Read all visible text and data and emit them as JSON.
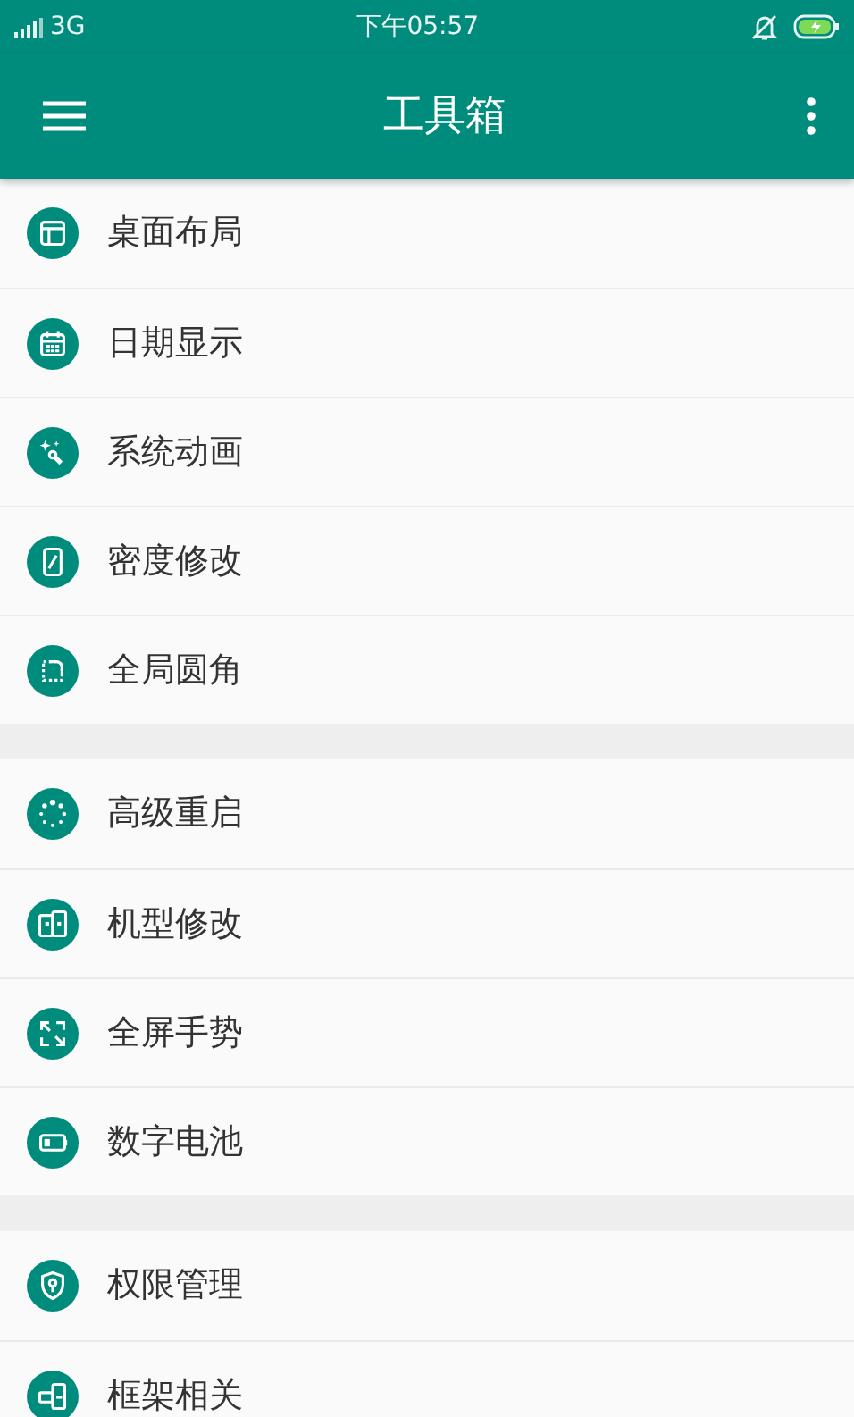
{
  "status_bar": {
    "network": "3G",
    "time": "下午05:57"
  },
  "toolbar": {
    "title": "工具箱"
  },
  "groups": [
    {
      "items": [
        {
          "kind": "layout",
          "label": "桌面布局"
        },
        {
          "kind": "calendar",
          "label": "日期显示"
        },
        {
          "kind": "sparkle",
          "label": "系统动画"
        },
        {
          "kind": "phone",
          "label": "密度修改"
        },
        {
          "kind": "corner",
          "label": "全局圆角"
        }
      ]
    },
    {
      "items": [
        {
          "kind": "dots",
          "label": "高级重启"
        },
        {
          "kind": "phones",
          "label": "机型修改"
        },
        {
          "kind": "expand",
          "label": "全屏手势"
        },
        {
          "kind": "battery",
          "label": "数字电池"
        }
      ]
    },
    {
      "items": [
        {
          "kind": "shield",
          "label": "权限管理"
        },
        {
          "kind": "devices",
          "label": "框架相关"
        }
      ]
    }
  ]
}
